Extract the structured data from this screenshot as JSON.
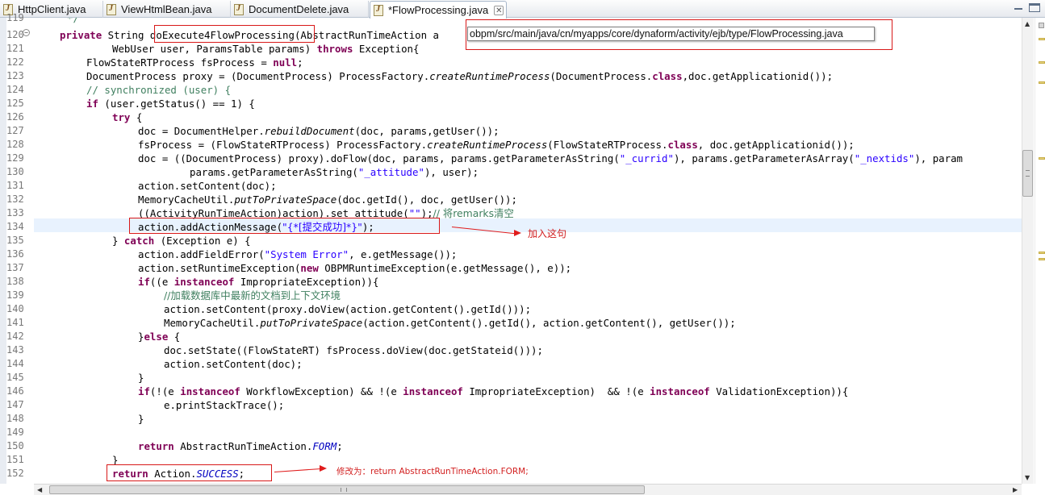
{
  "tabs": [
    {
      "label": "HttpClient.java",
      "active": false
    },
    {
      "label": "ViewHtmlBean.java",
      "active": false
    },
    {
      "label": "DocumentDelete.java",
      "active": false
    },
    {
      "label": "*FlowProcessing.java",
      "active": true
    }
  ],
  "tab_close_glyph": "✕",
  "line_numbers": [
    "119",
    "120",
    "121",
    "122",
    "123",
    "124",
    "125",
    "126",
    "127",
    "128",
    "129",
    "130",
    "131",
    "132",
    "133",
    "134",
    "135",
    "136",
    "137",
    "138",
    "139",
    "140",
    "141",
    "142",
    "143",
    "144",
    "145",
    "146",
    "147",
    "148",
    "149",
    "150",
    "151",
    "152"
  ],
  "code": {
    "l119": "*/",
    "l120": {
      "kw1": "private",
      "t1": " String ",
      "method": "doExecute4FlowProcessing",
      "t2": "(AbstractRunTimeAction a"
    },
    "l121": {
      "t1": "WebUser user, ParamsTable params) ",
      "kw1": "throws",
      "t2": " Exception{"
    },
    "l122": {
      "t1": "FlowStateRTProcess fsProcess = ",
      "kw1": "null",
      "t2": ";"
    },
    "l123": {
      "t1": "DocumentProcess proxy = (DocumentProcess) ProcessFactory.",
      "it1": "createRuntimeProcess",
      "t2": "(DocumentProcess.",
      "kw1": "class",
      "t3": ",doc.getApplicationid());"
    },
    "l124": "// synchronized (user) {",
    "l125": {
      "kw1": "if",
      "t1": " (user.getStatus() == 1) {"
    },
    "l126": {
      "kw1": "try",
      "t1": " {"
    },
    "l127": {
      "t1": "doc = DocumentHelper.",
      "it1": "rebuildDocument",
      "t2": "(doc, params,getUser());"
    },
    "l128": {
      "t1": "fsProcess = (FlowStateRTProcess) ProcessFactory.",
      "it1": "createRuntimeProcess",
      "t2": "(FlowStateRTProcess.",
      "kw1": "class",
      "t3": ", doc.getApplicationid());"
    },
    "l129": {
      "t1": "doc = ((DocumentProcess) proxy).doFlow(doc, params, params.getParameterAsString(",
      "s1": "\"_currid\"",
      "t2": "), params.getParameterAsArray(",
      "s2": "\"_nextids\"",
      "t3": "), param"
    },
    "l130": {
      "t1": "params.getParameterAsString(",
      "s1": "\"_attitude\"",
      "t2": "), user);"
    },
    "l131": "action.setContent(doc);",
    "l132": {
      "t1": "MemoryCacheUtil.",
      "it1": "putToPrivateSpace",
      "t2": "(doc.getId(), doc, getUser());"
    },
    "l133": {
      "t1": "((ActivityRunTimeAction)action).set attitude(",
      "s1": "\"\"",
      "t2": ");",
      "c1": "// 将remarks清空"
    },
    "l134": {
      "t1": "action.addActionMessage(",
      "s1": "\"{*[提交成功]*}\"",
      "t2": ");"
    },
    "l135": {
      "t1": "} ",
      "kw1": "catch",
      "t2": " (Exception e) {"
    },
    "l136": {
      "t1": "action.addFieldError(",
      "s1": "\"System Error\"",
      "t2": ", e.getMessage());"
    },
    "l137": {
      "t1": "action.setRuntimeException(",
      "kw1": "new",
      "t2": " OBPMRuntimeException(e.getMessage(), e));"
    },
    "l138": {
      "kw1": "if",
      "t1": "((e ",
      "kw2": "instanceof",
      "t2": " ImpropriateException)){"
    },
    "l139": "//加载数据库中最新的文档到上下文环境",
    "l140": "action.setContent(proxy.doView(action.getContent().getId()));",
    "l141": {
      "t1": "MemoryCacheUtil.",
      "it1": "putToPrivateSpace",
      "t2": "(action.getContent().getId(), action.getContent(), getUser());"
    },
    "l142": {
      "t1": "}",
      "kw1": "else",
      "t2": " {"
    },
    "l143": "doc.setState((FlowStateRT) fsProcess.doView(doc.getStateid()));",
    "l144": "action.setContent(doc);",
    "l145": "}",
    "l146": {
      "kw1": "if",
      "t1": "(!(e ",
      "kw2": "instanceof",
      "t2": " WorkflowException) && !(e ",
      "kw3": "instanceof",
      "t3": " ImpropriateException)  && !(e ",
      "kw4": "instanceof",
      "t4": " ValidationException)){"
    },
    "l147": "e.printStackTrace();",
    "l148": "}",
    "l150": {
      "kw1": "return",
      "t1": " AbstractRunTimeAction.",
      "cn1": "FORM",
      "t2": ";"
    },
    "l151": "}",
    "l152": {
      "kw1": "return",
      "t1": " Action.",
      "cn1": "SUCCESS",
      "t2": ";"
    }
  },
  "tooltip_path": "obpm/src/main/java/cn/myapps/core/dynaform/activity/ejb/type/FlowProcessing.java",
  "annotations": {
    "add_line": "加入这句",
    "change_to": "修改为：return AbstractRunTimeAction.FORM;"
  },
  "colors": {
    "keyword": "#7f0055",
    "string": "#2a00ff",
    "comment": "#3f7f5f",
    "annotation_red": "#d21f1f",
    "current_line": "#e8f2fe"
  }
}
